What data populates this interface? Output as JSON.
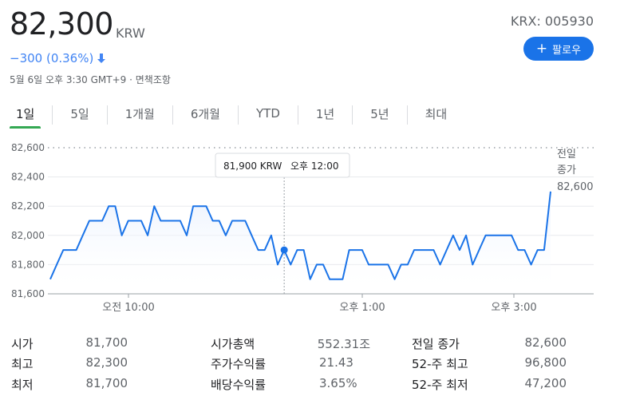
{
  "quote": {
    "price": "82,300",
    "currency": "KRW",
    "change": "−300 (0.36%)",
    "timestamp": "5월 6일 오후 3:30 GMT+9 · 면책조항",
    "ticker": "KRX: 005930",
    "follow_label": "팔로우",
    "change_color": "#4285f4"
  },
  "tabs": [
    "1일",
    "5일",
    "1개월",
    "6개월",
    "YTD",
    "1년",
    "5년",
    "최대"
  ],
  "active_tab": "1일",
  "tooltip": {
    "value": "81,900 KRW",
    "time": "오후 12:00"
  },
  "prev_close": {
    "label_line1": "전일",
    "label_line2": "종가",
    "value": "82,600"
  },
  "chart_data": {
    "type": "line",
    "title": "",
    "xlabel": "",
    "ylabel": "",
    "ylim": [
      81600,
      82600
    ],
    "yticks": [
      "82,600",
      "82,400",
      "82,200",
      "82,000",
      "81,800",
      "81,600"
    ],
    "xtick_labels": [
      "오전 10:00",
      "오후 1:00",
      "오후 3:00"
    ],
    "line_color": "#1a73e8",
    "previous_close": 82600,
    "series": [
      {
        "values": [
          81700,
          81800,
          81900,
          81900,
          81900,
          82000,
          82100,
          82100,
          82100,
          82200,
          82200,
          82000,
          82100,
          82100,
          82100,
          82000,
          82200,
          82100,
          82100,
          82100,
          82100,
          82000,
          82200,
          82200,
          82200,
          82100,
          82100,
          82000,
          82100,
          82100,
          82100,
          82000,
          81900,
          81900,
          82000,
          81800,
          81900,
          81800,
          81900,
          81900,
          81700,
          81800,
          81800,
          81700,
          81700,
          81700,
          81900,
          81900,
          81900,
          81800,
          81800,
          81800,
          81800,
          81700,
          81800,
          81800,
          81900,
          81900,
          81900,
          81900,
          81800,
          81900,
          82000,
          81900,
          82000,
          81800,
          81900,
          82000,
          82000,
          82000,
          82000,
          82000,
          81900,
          81900,
          81800,
          81900,
          81900,
          82300
        ]
      }
    ]
  },
  "stats": [
    {
      "label": "시가",
      "value": "81,700"
    },
    {
      "label": "최고",
      "value": "82,300"
    },
    {
      "label": "최저",
      "value": "81,700"
    },
    {
      "label": "시가총액",
      "value": "552.31조"
    },
    {
      "label": "주가수익률",
      "value": "21.43"
    },
    {
      "label": "배당수익률",
      "value": "3.65%"
    },
    {
      "label": "전일 종가",
      "value": "82,600"
    },
    {
      "label": "52-주 최고",
      "value": "96,800"
    },
    {
      "label": "52-주 최저",
      "value": "47,200"
    }
  ]
}
